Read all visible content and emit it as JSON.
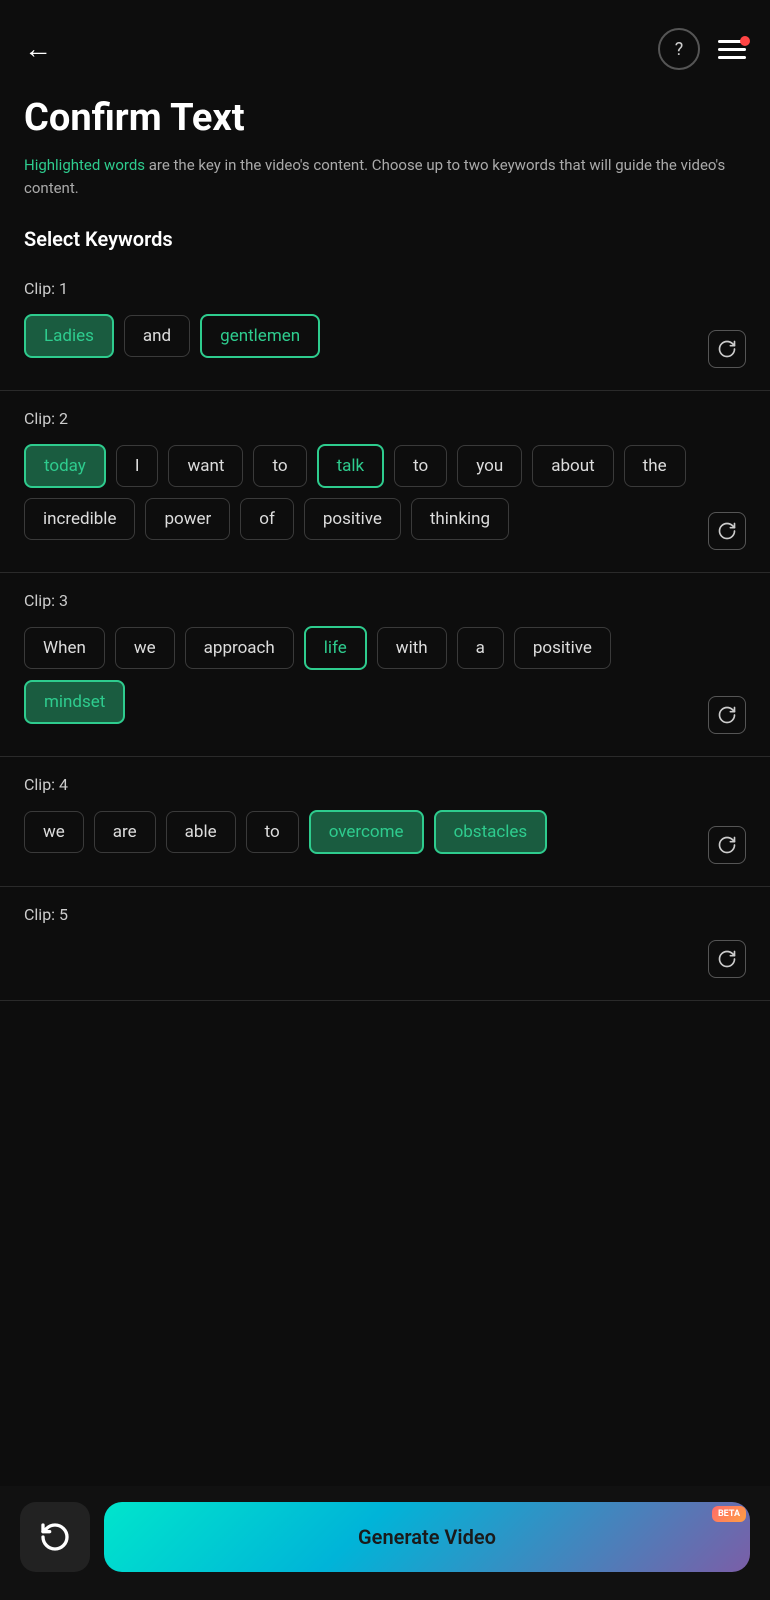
{
  "header": {
    "back_label": "←",
    "help_icon": "?",
    "menu_icon": "menu"
  },
  "page": {
    "title": "Confirm Text",
    "subtitle_normal": " are the key in the video's content. Choose up to two keywords that will guide the video's content.",
    "subtitle_highlight": "Highlighted words",
    "section_heading": "Select Keywords"
  },
  "clips": [
    {
      "label": "Clip: 1",
      "words": [
        {
          "text": "Ladies",
          "state": "filled"
        },
        {
          "text": "and",
          "state": "normal"
        },
        {
          "text": "gentlemen",
          "state": "outlined"
        }
      ]
    },
    {
      "label": "Clip: 2",
      "words": [
        {
          "text": "today",
          "state": "filled"
        },
        {
          "text": "I",
          "state": "normal"
        },
        {
          "text": "want",
          "state": "normal"
        },
        {
          "text": "to",
          "state": "normal"
        },
        {
          "text": "talk",
          "state": "outlined"
        },
        {
          "text": "to",
          "state": "normal"
        },
        {
          "text": "you",
          "state": "normal"
        },
        {
          "text": "about",
          "state": "normal"
        },
        {
          "text": "the",
          "state": "normal"
        },
        {
          "text": "incredible",
          "state": "normal"
        },
        {
          "text": "power",
          "state": "normal"
        },
        {
          "text": "of",
          "state": "normal"
        },
        {
          "text": "positive",
          "state": "normal"
        },
        {
          "text": "thinking",
          "state": "normal"
        }
      ]
    },
    {
      "label": "Clip: 3",
      "words": [
        {
          "text": "When",
          "state": "normal"
        },
        {
          "text": "we",
          "state": "normal"
        },
        {
          "text": "approach",
          "state": "normal"
        },
        {
          "text": "life",
          "state": "outlined"
        },
        {
          "text": "with",
          "state": "normal"
        },
        {
          "text": "a",
          "state": "normal"
        },
        {
          "text": "positive",
          "state": "normal"
        },
        {
          "text": "mindset",
          "state": "filled"
        }
      ]
    },
    {
      "label": "Clip: 4",
      "words": [
        {
          "text": "we",
          "state": "normal"
        },
        {
          "text": "are",
          "state": "normal"
        },
        {
          "text": "able",
          "state": "normal"
        },
        {
          "text": "to",
          "state": "normal"
        },
        {
          "text": "overcome",
          "state": "filled"
        },
        {
          "text": "obstacles",
          "state": "filled"
        }
      ]
    },
    {
      "label": "Clip: 5",
      "words": []
    }
  ],
  "bottom": {
    "reset_label": "↺",
    "generate_label": "Generate Video",
    "beta_label": "BETA"
  }
}
